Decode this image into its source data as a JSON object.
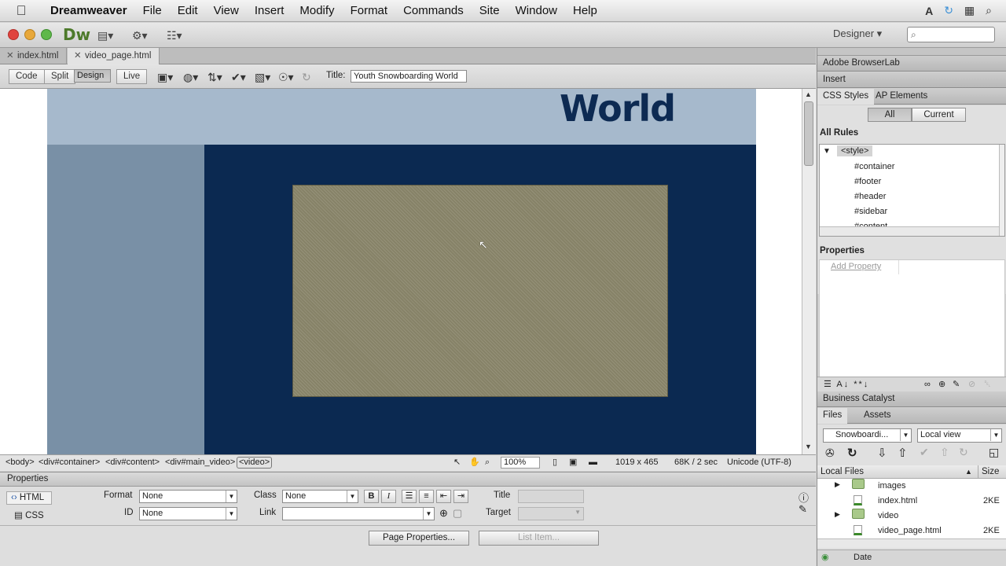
{
  "menubar": {
    "app": "Dreamweaver",
    "items": [
      "File",
      "Edit",
      "View",
      "Insert",
      "Modify",
      "Format",
      "Commands",
      "Site",
      "Window",
      "Help"
    ]
  },
  "appbar": {
    "logo": "Dw",
    "workspace": "Designer",
    "workspace_caret": "▾"
  },
  "tabs": [
    {
      "label": "index.html"
    },
    {
      "label": "video_page.html"
    }
  ],
  "doctoolbar": {
    "code": "Code",
    "split": "Split",
    "design": "Design",
    "live": "Live",
    "title_label": "Title:",
    "title_value": "Youth Snowboarding World"
  },
  "design": {
    "header_text": "World"
  },
  "statusbar": {
    "tags": [
      "<body>",
      "<div#container>",
      "<div#content>",
      "<div#main_video>",
      "<video>"
    ],
    "zoom": "100%",
    "dimensions": "1019 x 465",
    "size": "68K / 2 sec",
    "encoding": "Unicode (UTF-8)"
  },
  "properties": {
    "header": "Properties",
    "html_tab": "HTML",
    "css_tab": "CSS",
    "format_label": "Format",
    "format_value": "None",
    "id_label": "ID",
    "id_value": "None",
    "class_label": "Class",
    "class_value": "None",
    "link_label": "Link",
    "link_value": "",
    "title_label": "Title",
    "target_label": "Target",
    "bold": "B",
    "italic": "I",
    "page_properties": "Page Properties...",
    "list_item": "List Item..."
  },
  "rightpanel": {
    "browserlab": "Adobe BrowserLab",
    "insert": "Insert",
    "css_styles": "CSS Styles",
    "ap_elements": "AP Elements",
    "all": "All",
    "current": "Current",
    "all_rules": "All Rules",
    "rules": [
      "<style>",
      "#container",
      "#footer",
      "#header",
      "#sidebar",
      "#content"
    ],
    "properties": "Properties",
    "add_property": "Add Property",
    "business_catalyst": "Business Catalyst",
    "files_tab": "Files",
    "assets_tab": "Assets",
    "site": "Snowboardi...",
    "view": "Local view",
    "local_files": "Local Files",
    "size": "Size",
    "files": [
      {
        "name": "images",
        "size": ""
      },
      {
        "name": "index.html",
        "size": "2KE"
      },
      {
        "name": "video",
        "size": ""
      },
      {
        "name": "video_page.html",
        "size": "2KE"
      }
    ],
    "date_label": "Date"
  },
  "colors": {
    "header_bg": "#a6b9cc",
    "sidebar_bg": "#7990a6",
    "content_bg": "#0b2951",
    "video_bg": "#868267",
    "dw_green": "#4d7a2b"
  }
}
